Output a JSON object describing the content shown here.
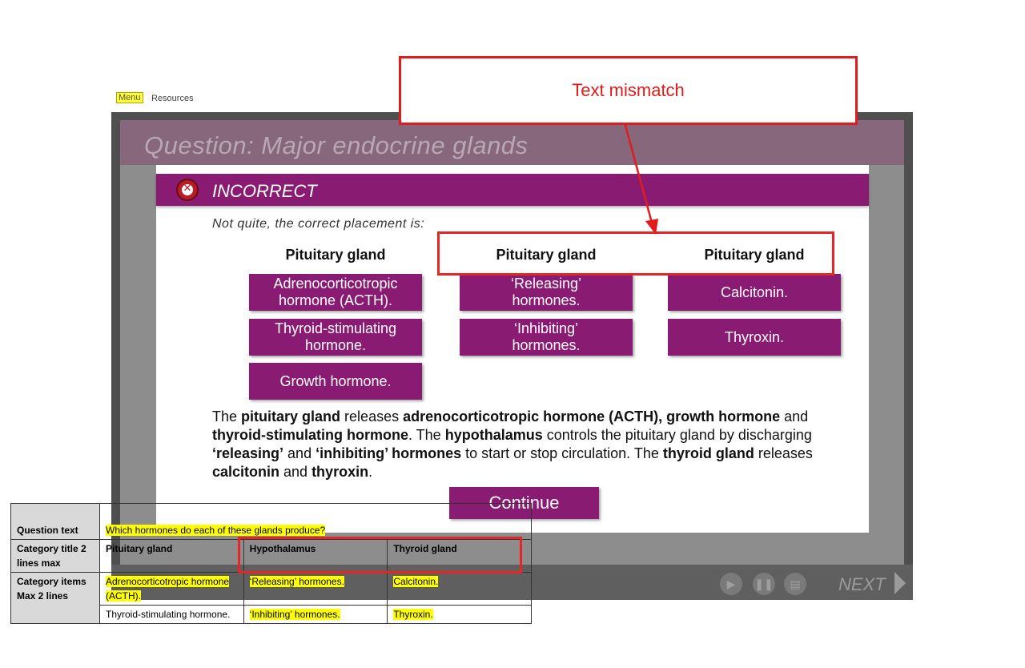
{
  "topnav": {
    "menu": "Menu",
    "resources": "Resources"
  },
  "slide": {
    "title": "Question: Major endocrine glands"
  },
  "dialog": {
    "status": "INCORRECT",
    "subtitle": "Not quite, the correct placement is:",
    "columns": [
      {
        "heading": "Pituitary gland",
        "items": [
          "Adrenocorticotropic hormone (ACTH).",
          "Thyroid-stimulating hormone.",
          "Growth hormone."
        ]
      },
      {
        "heading": "Pituitary gland",
        "items": [
          "‘Releasing’ hormones.",
          "‘Inhibiting’ hormones."
        ]
      },
      {
        "heading": "Pituitary gland",
        "items": [
          "Calcitonin.",
          "Thyroxin."
        ]
      }
    ],
    "feedback": [
      {
        "t": "The ",
        "b": false
      },
      {
        "t": "pituitary gland",
        "b": true
      },
      {
        "t": " releases ",
        "b": false
      },
      {
        "t": "adrenocorticotropic hormone (ACTH), growth hormone",
        "b": true
      },
      {
        "t": " and ",
        "b": false
      },
      {
        "t": "thyroid-stimulating hormone",
        "b": true
      },
      {
        "t": ". The ",
        "b": false
      },
      {
        "t": "hypothalamus",
        "b": true
      },
      {
        "t": " controls the pituitary gland by discharging ",
        "b": false
      },
      {
        "t": "‘releasing’",
        "b": true
      },
      {
        "t": " and ",
        "b": false
      },
      {
        "t": "‘inhibiting’ hormones",
        "b": true
      },
      {
        "t": " to start or stop circulation. The ",
        "b": false
      },
      {
        "t": "thyroid gland",
        "b": true
      },
      {
        "t": " releases ",
        "b": false
      },
      {
        "t": "calcitonin",
        "b": true
      },
      {
        "t": " and ",
        "b": false
      },
      {
        "t": "thyroxin",
        "b": true
      },
      {
        "t": ".",
        "b": false
      }
    ],
    "continue": "Continue"
  },
  "player": {
    "next": "NEXT",
    "play_icon": "play-icon",
    "pause_icon": "pause-icon",
    "captions_icon": "captions-icon"
  },
  "annotation": {
    "text": "Text mismatch",
    "color": "#e41b1b"
  },
  "doc_table": {
    "question_label": "Question text",
    "question_value": "Which hormones do each of these glands produce?",
    "category_title_label": "Category title 2 lines max",
    "titles": [
      "Pituitary gland",
      "Hypothalamus",
      "Thyroid gland"
    ],
    "category_items_label": "Category items Max 2 lines",
    "row1": [
      "Adrenocorticotropic hormone (ACTH).",
      "‘Releasing’ hormones.",
      "Calcitonin."
    ],
    "row2": [
      "Thyroid-stimulating hormone.",
      "‘Inhibiting’ hormones.",
      "Thyroxin."
    ]
  },
  "colors": {
    "purple": "#8a1b73",
    "highlight": "#ffff00",
    "annotation_red": "#e41b1b"
  }
}
